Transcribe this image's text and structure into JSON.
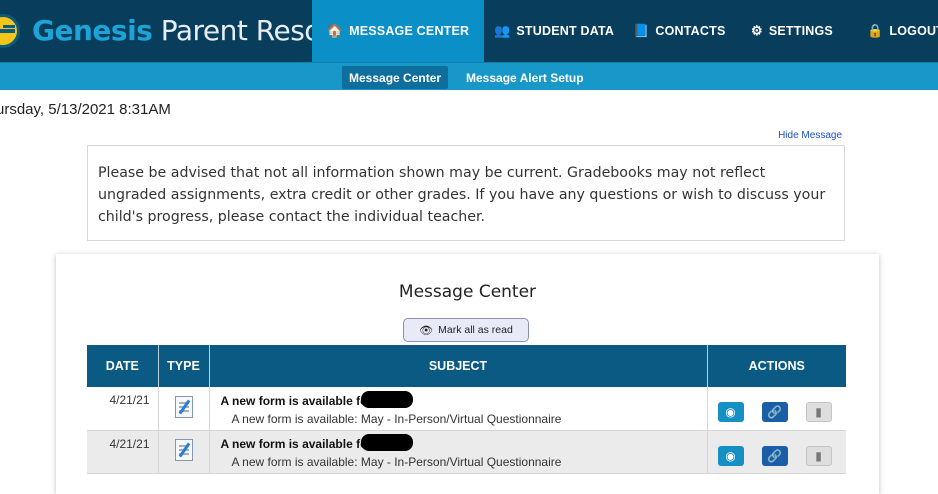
{
  "header": {
    "brand_part1": "Genesis",
    "brand_part2": "Parent Resources",
    "nav": [
      {
        "icon": "home-icon",
        "glyph": "🏠",
        "label": "MESSAGE CENTER"
      },
      {
        "icon": "people-icon",
        "glyph": "👥",
        "label": "STUDENT DATA"
      },
      {
        "icon": "book-icon",
        "glyph": "📘",
        "label": "CONTACTS"
      },
      {
        "icon": "gear-icon",
        "glyph": "⚙",
        "label": "SETTINGS"
      },
      {
        "icon": "lock-icon",
        "glyph": "🔒",
        "label": "LOGOUT"
      }
    ]
  },
  "subnav": {
    "items": [
      "Message Center",
      "Message Alert Setup"
    ]
  },
  "datetime": "ursday, 5/13/2021 8:31AM",
  "hide_message": "Hide Message",
  "notice": {
    "text": "Please be advised that not all information shown may be current. Gradebooks may not reflect ungraded assignments, extra credit or other grades. If you have any questions or wish to discuss your child's progress, please contact the individual teacher."
  },
  "message_center": {
    "title": "Message Center",
    "mark_all_read": "Mark all as read",
    "columns": [
      "DATE",
      "TYPE",
      "SUBJECT",
      "ACTIONS"
    ],
    "rows": [
      {
        "date": "4/21/21",
        "type_icon": "document-icon",
        "subject_title": "A new form is available fo",
        "subject_desc": "A new form is available: May - In-Person/Virtual Questionnaire"
      },
      {
        "date": "4/21/21",
        "type_icon": "document-icon",
        "subject_title": "A new form is available fo",
        "subject_desc": "A new form is available: May - In-Person/Virtual Questionnaire"
      }
    ],
    "action_icons": {
      "view": "eye-icon",
      "link": "link-icon",
      "delete": "trash-icon"
    }
  },
  "colors": {
    "topbar": "#083e5c",
    "active_nav": "#0a8fc6",
    "subbar": "#1898c8",
    "table_header": "#0a5a83"
  }
}
